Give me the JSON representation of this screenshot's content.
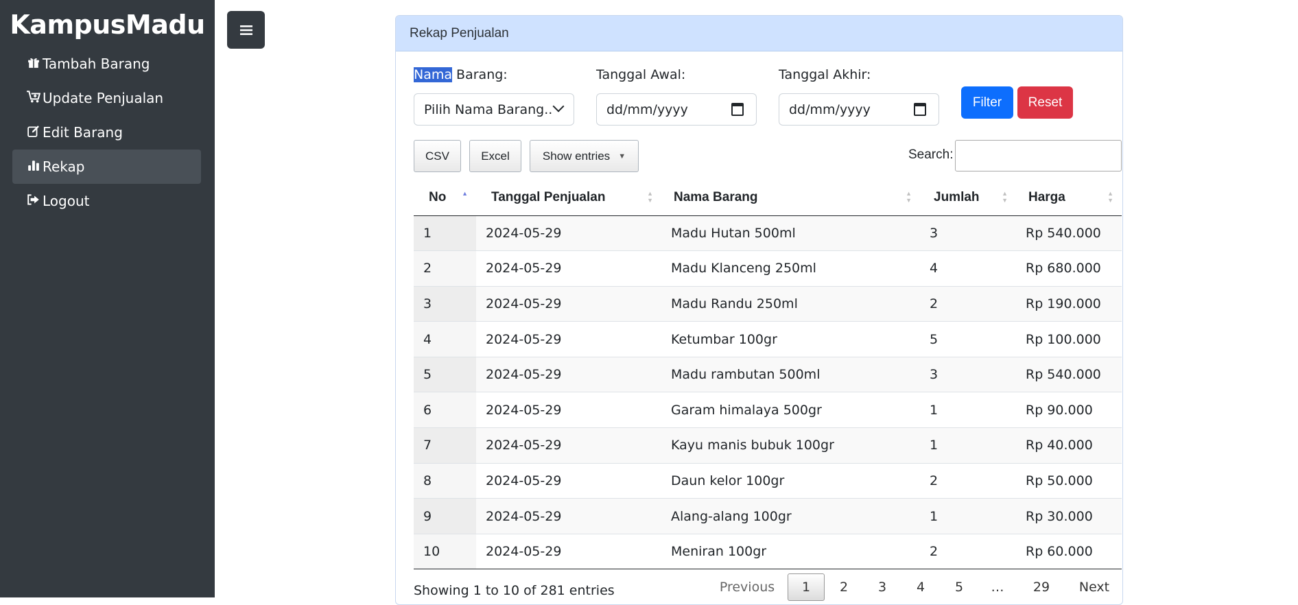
{
  "sidebar": {
    "brand": "KampusMadu",
    "items": [
      {
        "label": "Tambah Barang",
        "icon": "gift-icon"
      },
      {
        "label": "Update Penjualan",
        "icon": "cart-plus-icon"
      },
      {
        "label": "Edit Barang",
        "icon": "edit-icon"
      },
      {
        "label": "Rekap",
        "icon": "bar-chart-icon",
        "active": true
      },
      {
        "label": "Logout",
        "icon": "logout-icon"
      }
    ]
  },
  "toggle_icon": "hamburger-icon",
  "card": {
    "title": "Rekap Penjualan"
  },
  "filters": {
    "nama_label_selected": "Nama",
    "nama_label_rest": " Barang:",
    "nama_select_value": "Pilih Nama Barang..",
    "tanggal_awal_label": "Tanggal Awal:",
    "tanggal_awal_placeholder": "dd/mm/yyyy",
    "tanggal_akhir_label": "Tanggal Akhir:",
    "tanggal_akhir_placeholder": "dd/mm/yyyy",
    "filter_label": "Filter",
    "reset_label": "Reset"
  },
  "datatable": {
    "csv_label": "CSV",
    "excel_label": "Excel",
    "show_entries_label": "Show entries",
    "search_label": "Search:",
    "search_value": "",
    "columns": [
      "No",
      "Tanggal Penjualan",
      "Nama Barang",
      "Jumlah",
      "Harga"
    ],
    "rows": [
      [
        "1",
        "2024-05-29",
        "Madu Hutan 500ml",
        "3",
        "Rp 540.000"
      ],
      [
        "2",
        "2024-05-29",
        "Madu Klanceng 250ml",
        "4",
        "Rp 680.000"
      ],
      [
        "3",
        "2024-05-29",
        "Madu Randu 250ml",
        "2",
        "Rp 190.000"
      ],
      [
        "4",
        "2024-05-29",
        "Ketumbar 100gr",
        "5",
        "Rp 100.000"
      ],
      [
        "5",
        "2024-05-29",
        "Madu rambutan 500ml",
        "3",
        "Rp 540.000"
      ],
      [
        "6",
        "2024-05-29",
        "Garam himalaya 500gr",
        "1",
        "Rp 90.000"
      ],
      [
        "7",
        "2024-05-29",
        "Kayu manis bubuk 100gr",
        "1",
        "Rp 40.000"
      ],
      [
        "8",
        "2024-05-29",
        "Daun kelor 100gr",
        "2",
        "Rp 50.000"
      ],
      [
        "9",
        "2024-05-29",
        "Alang-alang 100gr",
        "1",
        "Rp 30.000"
      ],
      [
        "10",
        "2024-05-29",
        "Meniran 100gr",
        "2",
        "Rp 60.000"
      ]
    ],
    "info": "Showing 1 to 10 of 281 entries",
    "pagination": {
      "previous": "Previous",
      "pages": [
        "1",
        "2",
        "3",
        "4",
        "5",
        "…",
        "29"
      ],
      "next": "Next"
    }
  }
}
